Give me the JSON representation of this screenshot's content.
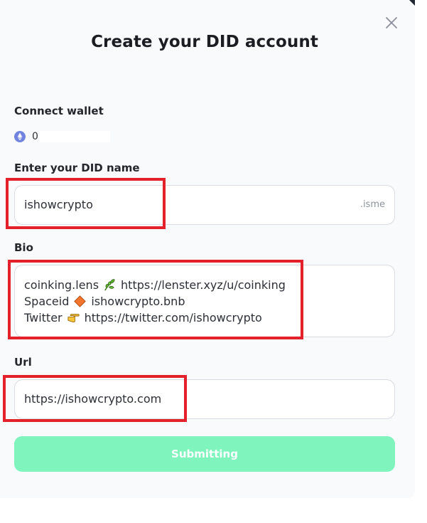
{
  "modal": {
    "title": "Create your DID account"
  },
  "wallet": {
    "label": "Connect wallet",
    "address_visible": "0",
    "icon": "ethereum-icon"
  },
  "did_name": {
    "label": "Enter your DID name",
    "value": "ishowcrypto",
    "suffix": ".isme"
  },
  "bio": {
    "label": "Bio",
    "lines": [
      {
        "before": "coinking.lens",
        "emoji": "herb-icon",
        "after": "https://lenster.xyz/u/coinking"
      },
      {
        "before": "Spaceid",
        "emoji": "orange-diamond-icon",
        "after": "ishowcrypto.bnb"
      },
      {
        "before": "Twitter",
        "emoji": "pointing-hand-icon",
        "after": "https://twitter.com/ishowcrypto"
      }
    ]
  },
  "url": {
    "label": "Url",
    "value": "https://ishowcrypto.com"
  },
  "actions": {
    "submit_label": "Submitting"
  },
  "colors": {
    "submit_bg": "#7ff4bd",
    "highlight": "#e4212b",
    "eth": "#7184e0"
  }
}
